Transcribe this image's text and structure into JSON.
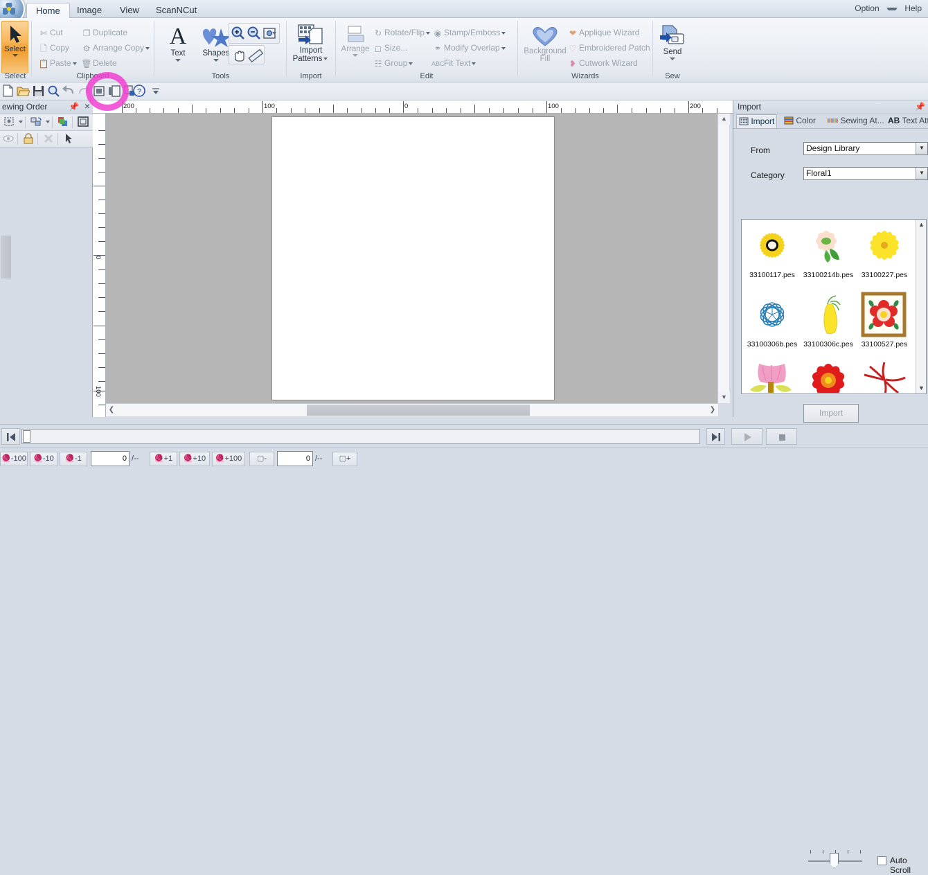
{
  "app": {
    "orb_label": "application-menu",
    "tabs": [
      {
        "label": "Home",
        "active": true
      },
      {
        "label": "Image",
        "active": false
      },
      {
        "label": "View",
        "active": false
      },
      {
        "label": "ScanNCut",
        "active": false
      }
    ],
    "right_menu": [
      {
        "label": "Option"
      },
      {
        "label": "Help"
      }
    ]
  },
  "ribbon": {
    "groups": [
      {
        "name": "Select",
        "label": "Select"
      },
      {
        "name": "Clipboard",
        "label": "Clipboard"
      },
      {
        "name": "Tools",
        "label": "Tools"
      },
      {
        "name": "Import",
        "label": "Import"
      },
      {
        "name": "Edit",
        "label": "Edit"
      },
      {
        "name": "Wizards",
        "label": "Wizards"
      },
      {
        "name": "Sew",
        "label": "Sew"
      }
    ],
    "select": {
      "label": "Select"
    },
    "clipboard": {
      "cut": "Cut",
      "copy": "Copy",
      "paste": "Paste",
      "duplicate": "Duplicate",
      "arrange_copy": "Arrange Copy",
      "delete": "Delete"
    },
    "tools": {
      "text": "Text",
      "shapes": "Shapes",
      "zoom_in": "zoom-in",
      "zoom_out": "zoom-out",
      "zoom_selection": "zoom-selection",
      "pan": "pan",
      "measure": "measure"
    },
    "import": {
      "line1": "Import",
      "line2": "Patterns"
    },
    "edit": {
      "arrange": "Arrange",
      "rotate_flip": "Rotate/Flip",
      "size": "Size...",
      "group": "Group",
      "stamp_emboss": "Stamp/Emboss",
      "modify_overlap": "Modify Overlap",
      "fit_text": "Fit Text"
    },
    "wizards": {
      "background_fill_line1": "Background",
      "background_fill_line2": "Fill",
      "applique": "Applique Wizard",
      "patch": "Embroidered Patch",
      "cutwork": "Cutwork Wizard"
    },
    "sew": {
      "send": "Send"
    }
  },
  "quick_access": {
    "buttons": [
      {
        "name": "new-file-icon"
      },
      {
        "name": "open-file-icon"
      },
      {
        "name": "save-icon"
      },
      {
        "name": "zoom-icon"
      },
      {
        "name": "undo-icon"
      },
      {
        "name": "redo-icon"
      },
      {
        "name": "panel-toggle-1-icon"
      },
      {
        "name": "panel-toggle-2-icon"
      },
      {
        "name": "panel-toggle-3-icon"
      },
      {
        "name": "help-icon"
      },
      {
        "name": "customize-qat-icon"
      }
    ]
  },
  "left_dock": {
    "title": "ewing Order",
    "pin": "pin-icon",
    "close": "close-icon"
  },
  "rulers": {
    "horizontal_labels": [
      "200",
      "100",
      "0",
      "100",
      "200"
    ],
    "vertical_labels": [
      "0",
      "100"
    ],
    "unit": "mm"
  },
  "right_dock": {
    "title": "Import",
    "pin": "pin-icon",
    "tabs": [
      {
        "label": "Import",
        "icon": "import-grid-icon",
        "selected": true
      },
      {
        "label": "Color",
        "icon": "thread-spool-icon",
        "selected": false
      },
      {
        "label": "Sewing At...",
        "icon": "stitch-icon",
        "selected": false
      },
      {
        "label": "Text Attrib",
        "icon": "AB",
        "selected": false
      }
    ],
    "from": {
      "label": "From",
      "value": "Design Library"
    },
    "category": {
      "label": "Category",
      "value": "Floral1"
    },
    "import_button": "Import",
    "gallery": {
      "rows": [
        [
          {
            "name": "33100117.pes",
            "kind": "sunflower"
          },
          {
            "name": "33100214b.pes",
            "kind": "daisy-peach"
          },
          {
            "name": "33100227.pes",
            "kind": "yellow-bloom"
          }
        ],
        [
          {
            "name": "33100306b.pes",
            "kind": "blue-outline-flower"
          },
          {
            "name": "33100306c.pes",
            "kind": "yellow-bell"
          },
          {
            "name": "33100527.pes",
            "kind": "framed-red-flowers"
          }
        ],
        [
          {
            "name": "",
            "kind": "pink-tulip"
          },
          {
            "name": "",
            "kind": "red-star-flower"
          },
          {
            "name": "",
            "kind": "red-sparse-flower"
          }
        ]
      ]
    }
  },
  "playback": {
    "start_button": "skip-to-start-icon",
    "end_button": "skip-to-end-icon",
    "play_button": "play-icon",
    "stop_button": "stop-icon",
    "auto_scroll_label": "Auto Scroll",
    "auto_scroll_checked": false,
    "speed_ticks": 5
  },
  "status_bar": {
    "stitch_back": [
      {
        "label": "-100"
      },
      {
        "label": "-10"
      },
      {
        "label": "-1"
      }
    ],
    "stitch_value": "0",
    "stitch_total": "/--",
    "stitch_fwd": [
      {
        "label": "+1"
      },
      {
        "label": "+10"
      },
      {
        "label": "+100"
      }
    ],
    "color_minus": "-",
    "color_value": "0",
    "color_total": "/--",
    "color_plus": "+"
  },
  "colors": {
    "accent_orange": "#f09b2c",
    "annotation_magenta": "#f03fd0",
    "canvas_gray": "#b6b6b6",
    "chrome": "#d6dce5"
  }
}
